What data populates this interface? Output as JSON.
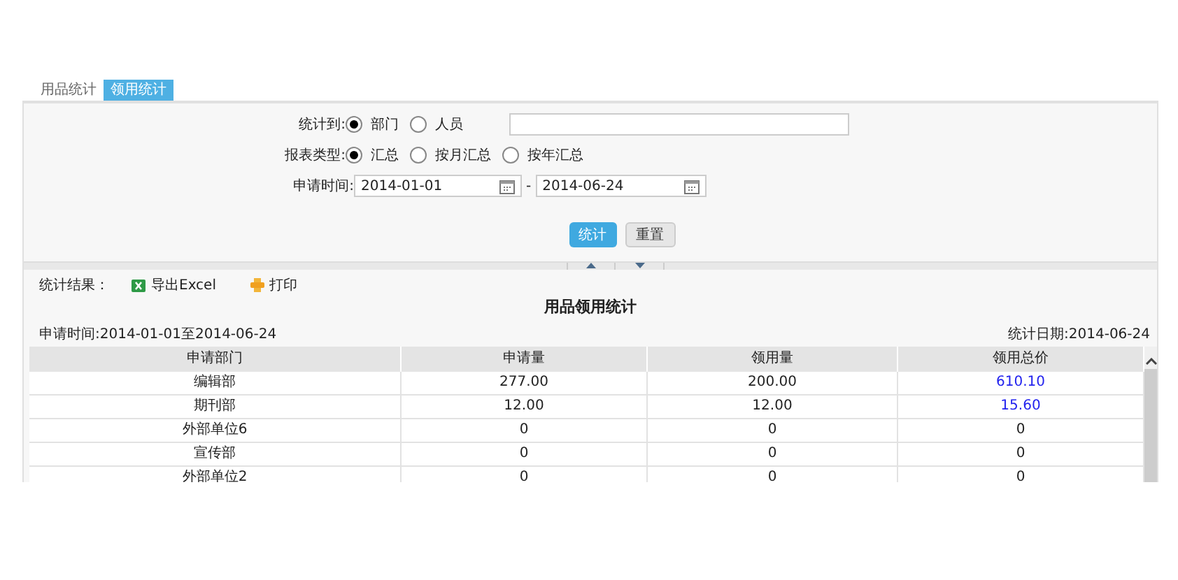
{
  "tabs": [
    {
      "label": "用品统计",
      "selected": false
    },
    {
      "label": "领用统计",
      "selected": true
    }
  ],
  "form": {
    "stat_to": {
      "label": "统计到:",
      "options": [
        {
          "label": "部门",
          "selected": true
        },
        {
          "label": "人员",
          "selected": false
        }
      ]
    },
    "report_type": {
      "label": "报表类型:",
      "options": [
        {
          "label": "汇总",
          "selected": true
        },
        {
          "label": "按月汇总",
          "selected": false
        },
        {
          "label": "按年汇总",
          "selected": false
        }
      ]
    },
    "apply_time": {
      "label": "申请时间:",
      "from": "2014-01-01",
      "separator": "-",
      "to": "2014-06-24"
    },
    "buttons": [
      {
        "label": "统计",
        "kind": "primary"
      },
      {
        "label": "重置",
        "kind": "secondary"
      }
    ]
  },
  "results": {
    "label": "统计结果：",
    "export": "导出Excel",
    "print": "打印",
    "title": "用品领用统计",
    "period": "申请时间:2014-01-01至2014-06-24",
    "date": "统计日期:2014-06-24",
    "columns": [
      "申请部门",
      "申请量",
      "领用量",
      "领用总价"
    ],
    "rows": [
      {
        "department": "编辑部",
        "requested": "277.00",
        "issued": "200.00",
        "total": "610.10",
        "total_link": true
      },
      {
        "department": "期刊部",
        "requested": "12.00",
        "issued": "12.00",
        "total": "15.60",
        "total_link": true
      },
      {
        "department": "外部单位6",
        "requested": "0",
        "issued": "0",
        "total": "0",
        "total_link": false
      },
      {
        "department": "宣传部",
        "requested": "0",
        "issued": "0",
        "total": "0",
        "total_link": false
      },
      {
        "department": "外部单位2",
        "requested": "0",
        "issued": "0",
        "total": "0",
        "total_link": false
      }
    ]
  }
}
